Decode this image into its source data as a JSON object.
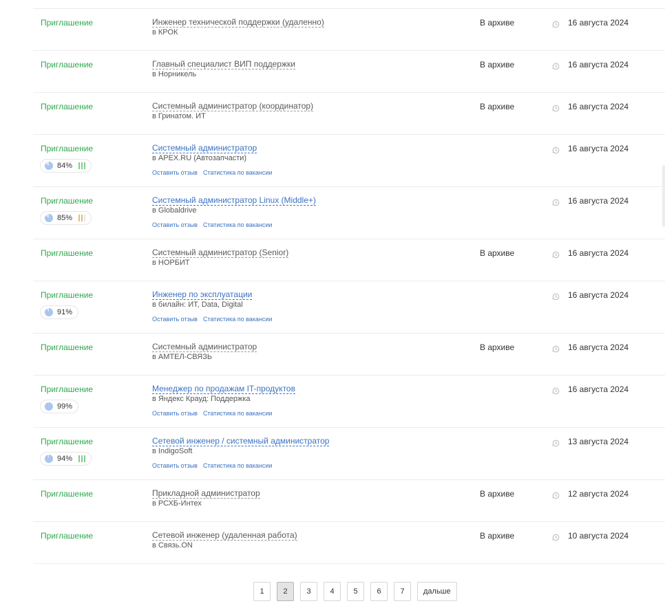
{
  "colors": {
    "status": "#2fa84f",
    "link": "#3a72c4",
    "bar_green": "#7ed08a",
    "bar_orange": "#e8b97a",
    "pie_fill": "#a9c6f0"
  },
  "rows": [
    {
      "status": "Приглашение",
      "title": "Инженер технической поддержки (удаленно)",
      "company": "в КРОК",
      "archive": "В архиве",
      "date": "16 августа 2024",
      "active": false
    },
    {
      "status": "Приглашение",
      "title": "Главный специалист ВИП поддержки",
      "company": "в Норникель",
      "archive": "В архиве",
      "date": "16 августа 2024",
      "active": false
    },
    {
      "status": "Приглашение",
      "title": "Системный администратор (координатор)",
      "company": "в Гринатом. ИТ",
      "archive": "В архиве",
      "date": "16 августа 2024",
      "active": false
    },
    {
      "status": "Приглашение",
      "title": "Системный администратор",
      "company": "в APEX.RU (Автозапчасти)",
      "archive": "",
      "date": "16 августа 2024",
      "active": true,
      "match": "84%",
      "match_value": 84,
      "bars": "green",
      "feedback": "Оставить отзыв",
      "stats": "Статистика по вакансии"
    },
    {
      "status": "Приглашение",
      "title": "Системный администратор Linux (Middle+)",
      "company": "в Globaldrive",
      "archive": "",
      "date": "16 августа 2024",
      "active": true,
      "match": "85%",
      "match_value": 85,
      "bars": "orange",
      "feedback": "Оставить отзыв",
      "stats": "Статистика по вакансии"
    },
    {
      "status": "Приглашение",
      "title": "Системный администратор (Senior)",
      "company": "в НОРБИТ",
      "archive": "В архиве",
      "date": "16 августа 2024",
      "active": false
    },
    {
      "status": "Приглашение",
      "title": "Инженер по эксплуатации",
      "company": "в билайн: ИТ, Data, Digital",
      "archive": "",
      "date": "16 августа 2024",
      "active": true,
      "match": "91%",
      "match_value": 91,
      "bars": "",
      "feedback": "Оставить отзыв",
      "stats": "Статистика по вакансии"
    },
    {
      "status": "Приглашение",
      "title": "Системный администратор",
      "company": "в АМТЕЛ-СВЯЗЬ",
      "archive": "В архиве",
      "date": "16 августа 2024",
      "active": false
    },
    {
      "status": "Приглашение",
      "title": "Менеджер по продажам IT-продуктов",
      "company": "в Яндекс Крауд: Поддержка",
      "archive": "",
      "date": "16 августа 2024",
      "active": true,
      "match": "99%",
      "match_value": 99,
      "bars": "",
      "feedback": "Оставить отзыв",
      "stats": "Статистика по вакансии"
    },
    {
      "status": "Приглашение",
      "title": "Сетевой инженер / системный администратор",
      "company": "в IndigoSoft",
      "archive": "",
      "date": "13 августа 2024",
      "active": true,
      "match": "94%",
      "match_value": 94,
      "bars": "green",
      "feedback": "Оставить отзыв",
      "stats": "Статистика по вакансии"
    },
    {
      "status": "Приглашение",
      "title": "Прикладной администратор",
      "company": "в РСХБ-Интех",
      "archive": "В архиве",
      "date": "12 августа 2024",
      "active": false
    },
    {
      "status": "Приглашение",
      "title": "Сетевой инженер (удаленная работа)",
      "company": "в Связь.ON",
      "archive": "В архиве",
      "date": "10 августа 2024",
      "active": false
    }
  ],
  "pager": {
    "pages": [
      "1",
      "2",
      "3",
      "4",
      "5",
      "6",
      "7"
    ],
    "current": "2",
    "next": "дальше"
  }
}
